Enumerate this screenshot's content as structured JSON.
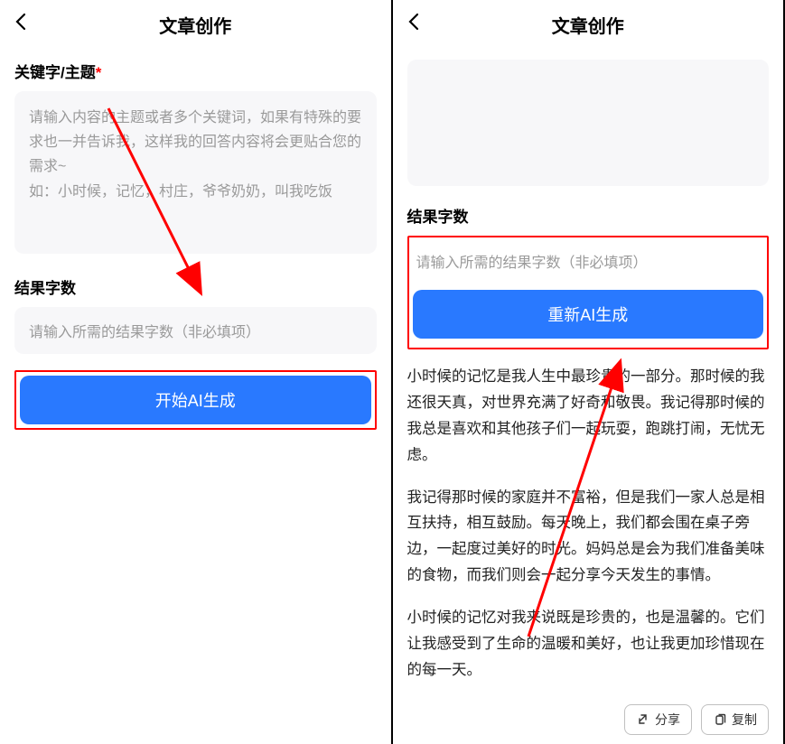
{
  "left": {
    "header_title": "文章创作",
    "keyword_label": "关键字/主题",
    "required_mark": "*",
    "keyword_placeholder": "请输入内容的主题或者多个关键词，如果有特殊的要求也一并告诉我，这样我的回答内容将会更贴合您的需求~\n如：小时候，记忆，村庄，爷爷奶奶，叫我吃饭",
    "count_label": "结果字数",
    "count_placeholder": "请输入所需的结果字数（非必填项）",
    "generate_btn": "开始AI生成"
  },
  "right": {
    "header_title": "文章创作",
    "count_label": "结果字数",
    "count_placeholder": "请输入所需的结果字数（非必填项）",
    "regenerate_btn": "重新AI生成",
    "result_p1": "小时候的记忆是我人生中最珍贵的一部分。那时候的我还很天真，对世界充满了好奇和敬畏。我记得那时候的我总是喜欢和其他孩子们一起玩耍，跑跳打闹，无忧无虑。",
    "result_p2": "我记得那时候的家庭并不富裕，但是我们一家人总是相互扶持，相互鼓励。每天晚上，我们都会围在桌子旁边，一起度过美好的时光。妈妈总是会为我们准备美味的食物，而我们则会一起分享今天发生的事情。",
    "result_p3": "小时候的记忆对我来说既是珍贵的，也是温馨的。它们让我感受到了生命的温暖和美好，也让我更加珍惜现在的每一天。",
    "share_label": "分享",
    "copy_label": "复制"
  }
}
